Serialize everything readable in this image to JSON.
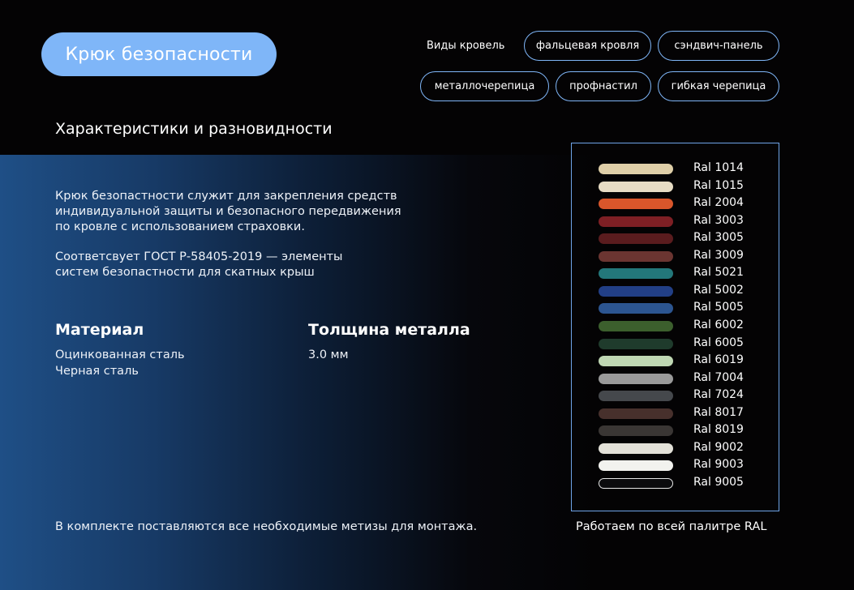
{
  "header": {
    "title": "Крюк безопасности",
    "roof_types_label": "Виды кровель",
    "roof_tags": [
      "фальцевая кровля",
      "сэндвич-панель",
      "металлочерепица",
      "профнастил",
      "гибкая черепица"
    ]
  },
  "main": {
    "section_title": "Характеристики и разновидности",
    "description": [
      "Крюк безопастности служит для закрепления средств",
      "индивидуальной защиты и безопасного передвижения",
      "по кровле с использованием страховки."
    ],
    "standard": [
      "Соответсвует ГОСТ Р-58405-2019 — элементы",
      "систем безопастности для скатных крыш"
    ],
    "material": {
      "label": "Материал",
      "values": [
        "Оцинкованная сталь",
        "Черная сталь"
      ]
    },
    "thickness": {
      "label": "Толщина металла",
      "value": "3.0 мм"
    },
    "footer_note": "В комплекте поставляются все необходимые метизы для монтажа."
  },
  "palette": {
    "items": [
      {
        "name": "Ral 1014",
        "color": "#dfcfa8"
      },
      {
        "name": "Ral 1015",
        "color": "#e7dcc4"
      },
      {
        "name": "Ral 2004",
        "color": "#d9562b"
      },
      {
        "name": "Ral 3003",
        "color": "#7e1f24"
      },
      {
        "name": "Ral 3005",
        "color": "#5a1c1e"
      },
      {
        "name": "Ral 3009",
        "color": "#6b3531"
      },
      {
        "name": "Ral 5021",
        "color": "#23777a"
      },
      {
        "name": "Ral 5002",
        "color": "#223f86"
      },
      {
        "name": "Ral 5005",
        "color": "#2c5590"
      },
      {
        "name": "Ral 6002",
        "color": "#3c5f2d"
      },
      {
        "name": "Ral 6005",
        "color": "#1f3b2c"
      },
      {
        "name": "Ral 6019",
        "color": "#bfd7b3"
      },
      {
        "name": "Ral 7004",
        "color": "#9a9a9a"
      },
      {
        "name": "Ral 7024",
        "color": "#45484c"
      },
      {
        "name": "Ral 8017",
        "color": "#47302c"
      },
      {
        "name": "Ral 8019",
        "color": "#3a3634"
      },
      {
        "name": "Ral 9002",
        "color": "#e3e1d8"
      },
      {
        "name": "Ral 9003",
        "color": "#f2f2ee"
      },
      {
        "name": "Ral 9005",
        "color": "#0b0b0d"
      }
    ],
    "caption": "Работаем по всей палитре RAL"
  }
}
